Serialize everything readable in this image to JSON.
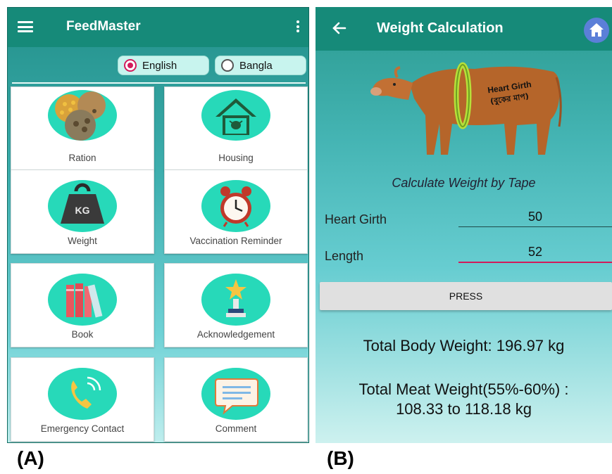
{
  "panel_a": {
    "app_title": "FeedMaster",
    "languages": [
      {
        "label": "English",
        "selected": true
      },
      {
        "label": "Bangla",
        "selected": false
      }
    ],
    "menu": [
      {
        "label": "Ration",
        "icon": "grain-feed-icon"
      },
      {
        "label": "Housing",
        "icon": "cow-house-icon"
      },
      {
        "label": "Weight",
        "icon": "kg-weight-icon"
      },
      {
        "label": "Vaccination Reminder",
        "icon": "alarm-clock-icon"
      },
      {
        "label": "Book",
        "icon": "books-icon"
      },
      {
        "label": "Acknowledgement",
        "icon": "trophy-icon"
      },
      {
        "label": "Emergency Contact",
        "icon": "phone-icon"
      },
      {
        "label": "Comment",
        "icon": "chat-bubble-icon"
      }
    ],
    "caption": "(A)"
  },
  "panel_b": {
    "app_title": "Weight Calculation",
    "image_text": {
      "line1": "Heart Girth",
      "line2": "(বুকের মাপ)"
    },
    "caption_text": "Calculate Weight by Tape",
    "fields": {
      "heart_girth": {
        "label": "Heart Girth",
        "value": "50"
      },
      "length": {
        "label": "Length",
        "value": "52"
      }
    },
    "press_label": "PRESS",
    "body_weight": "Total Body Weight: 196.97 kg",
    "meat_weight_line1": "Total Meat Weight(55%-60%) :",
    "meat_weight_line2": "108.33 to 118.18 kg",
    "caption": "(B)"
  },
  "colors": {
    "appbar": "#168a79",
    "accent": "#d21b5b",
    "icon_disc": "#27d9b9"
  }
}
